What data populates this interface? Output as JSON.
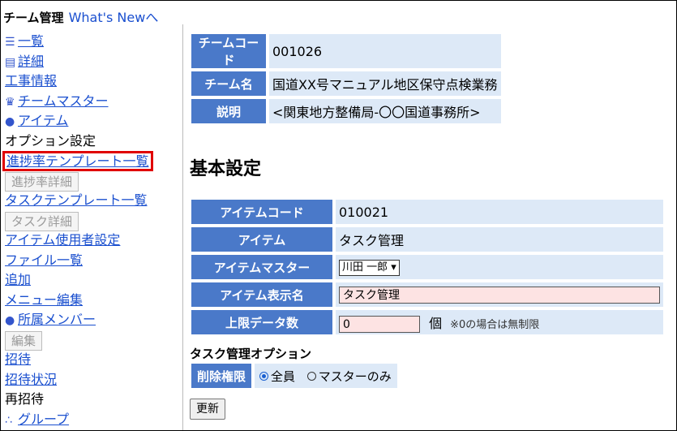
{
  "header": {
    "title": "チーム管理",
    "whats_new_link": "What's Newへ"
  },
  "sidebar": {
    "items": [
      {
        "label": "一覧",
        "icon": "list-icon"
      },
      {
        "label": "詳細",
        "icon": "document-icon"
      },
      {
        "label": "工事情報"
      },
      {
        "label": "チームマスター",
        "icon": "crown-icon"
      },
      {
        "label": "アイテム",
        "icon": "item-icon"
      },
      {
        "label": "オプション設定"
      },
      {
        "label": "進捗率テンプレート一覧"
      },
      {
        "label": "進捗率詳細"
      },
      {
        "label": "タスクテンプレート一覧"
      },
      {
        "label": "タスク詳細"
      },
      {
        "label": "アイテム使用者設定"
      },
      {
        "label": "ファイル一覧"
      },
      {
        "label": "追加"
      },
      {
        "label": "メニュー編集"
      },
      {
        "label": "所属メンバー",
        "icon": "person-icon"
      },
      {
        "label": "編集"
      },
      {
        "label": "招待"
      },
      {
        "label": "招待状況"
      },
      {
        "label": "再招待"
      },
      {
        "label": "グループ",
        "icon": "group-icon"
      }
    ]
  },
  "team_info": {
    "code_label": "チームコード",
    "code_value": "001026",
    "name_label": "チーム名",
    "name_value": "国道XX号マニュアル地区保守点検業務",
    "desc_label": "説明",
    "desc_value": "<関東地方整備局-〇〇国道事務所>"
  },
  "basic_settings": {
    "heading": "基本設定",
    "item_code_label": "アイテムコード",
    "item_code_value": "010021",
    "item_label": "アイテム",
    "item_value": "タスク管理",
    "item_master_label": "アイテムマスター",
    "item_master_selected": "川田 一郎",
    "display_name_label": "アイテム表示名",
    "display_name_value": "タスク管理",
    "max_data_label": "上限データ数",
    "max_data_value": "0",
    "max_data_unit": "個",
    "max_data_note": "※0の場合は無制限"
  },
  "task_options": {
    "title": "タスク管理オプション",
    "delete_perm_label": "削除権限",
    "opt_all": "全員",
    "opt_master": "マスターのみ",
    "selected": "全員"
  },
  "update_button": "更新",
  "colors": {
    "header_cell": "#4a79c9",
    "value_cell": "#dde9f7",
    "highlight": "#e00000",
    "link": "#1a4fcf"
  }
}
